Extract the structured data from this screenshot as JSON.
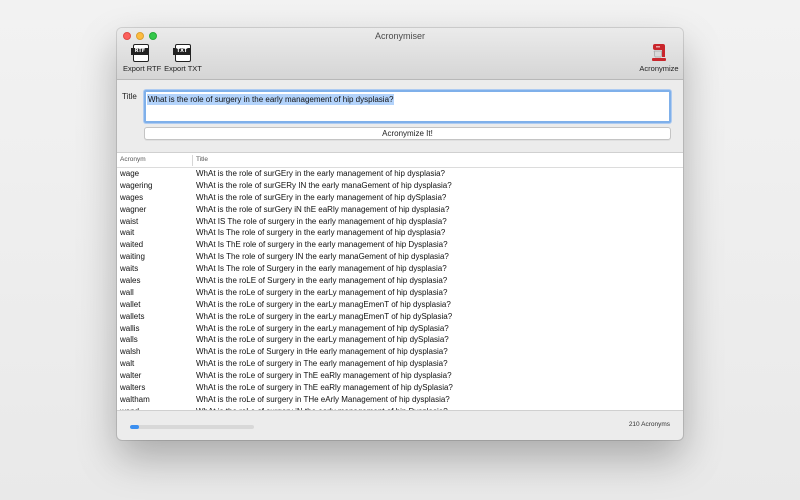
{
  "window": {
    "title": "Acronymiser"
  },
  "toolbar": {
    "export_rtf": {
      "label": "Export RTF",
      "tag": "RTF"
    },
    "export_txt": {
      "label": "Export TXT",
      "tag": "TXT"
    },
    "acronymize": {
      "label": "Acronymize"
    }
  },
  "form": {
    "title_label": "Title",
    "title_value": "What is the role of surgery in the early management of hip dysplasia?",
    "button_label": "Acronymize It!"
  },
  "table": {
    "columns": [
      "Acronym",
      "Title"
    ],
    "rows": [
      [
        "wage",
        "WhAt is the role of surGEry in the early management of hip dysplasia?"
      ],
      [
        "wagering",
        "WhAt is the role of surGERy IN the early manaGement of hip dysplasia?"
      ],
      [
        "wages",
        "WhAt is the role of surGEry in the early management of hip dySplasia?"
      ],
      [
        "wagner",
        "WhAt is the role of surGery iN thE eaRly management of hip dysplasia?"
      ],
      [
        "waist",
        "WhAt IS The role of surgery in the early management of hip dysplasia?"
      ],
      [
        "wait",
        "WhAt Is The role of surgery in the early management of hip dysplasia?"
      ],
      [
        "waited",
        "WhAt Is ThE role of surgery in the early management of hip Dysplasia?"
      ],
      [
        "waiting",
        "WhAt Is The role of surgery IN the early manaGement of hip dysplasia?"
      ],
      [
        "waits",
        "WhAt Is The role of Surgery in the early management of hip dysplasia?"
      ],
      [
        "wales",
        "WhAt is the roLE of Surgery in the early management of hip dysplasia?"
      ],
      [
        "wall",
        "WhAt is the roLe of surgery in the earLy management of hip dysplasia?"
      ],
      [
        "wallet",
        "WhAt is the roLe of surgery in the earLy managEmenT of hip dysplasia?"
      ],
      [
        "wallets",
        "WhAt is the roLe of surgery in the earLy managEmenT of hip dySplasia?"
      ],
      [
        "wallis",
        "WhAt is the roLe of surgery in the earLy management of hip dySplasia?"
      ],
      [
        "walls",
        "WhAt is the roLe of surgery in the earLy management of hip dySplasia?"
      ],
      [
        "walsh",
        "WhAt is the roLe of Surgery in tHe early management of hip dysplasia?"
      ],
      [
        "walt",
        "WhAt is the roLe of surgery in The early management of hip dysplasia?"
      ],
      [
        "walter",
        "WhAt is the roLe of surgery in ThE eaRly management of hip dysplasia?"
      ],
      [
        "walters",
        "WhAt is the roLe of surgery in ThE eaRly management of hip dySplasia?"
      ],
      [
        "waltham",
        "WhAt is the roLe of surgery in THe eArly Management of hip dysplasia?"
      ],
      [
        "wand",
        "WhAt is the roLe of surgery iN the early management of hip Dysplasia?"
      ]
    ]
  },
  "status": {
    "progress": 0.07,
    "count_text": "210 Acronyms",
    "accent": "#3b8ff0"
  }
}
